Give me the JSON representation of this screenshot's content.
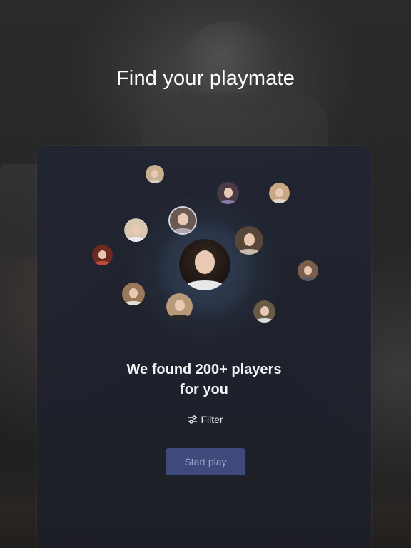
{
  "header": {
    "title": "Find your playmate"
  },
  "results": {
    "headline_line1": "We found 200+ players",
    "headline_line2": "for you"
  },
  "filter": {
    "label": "Filter",
    "icon": "sliders-icon"
  },
  "actions": {
    "start_label": "Start play"
  },
  "colors": {
    "primary_button": "#3e4a7c",
    "primary_button_text": "#9aa4c8",
    "card_background": "#212532",
    "text_primary": "#ffffff"
  }
}
